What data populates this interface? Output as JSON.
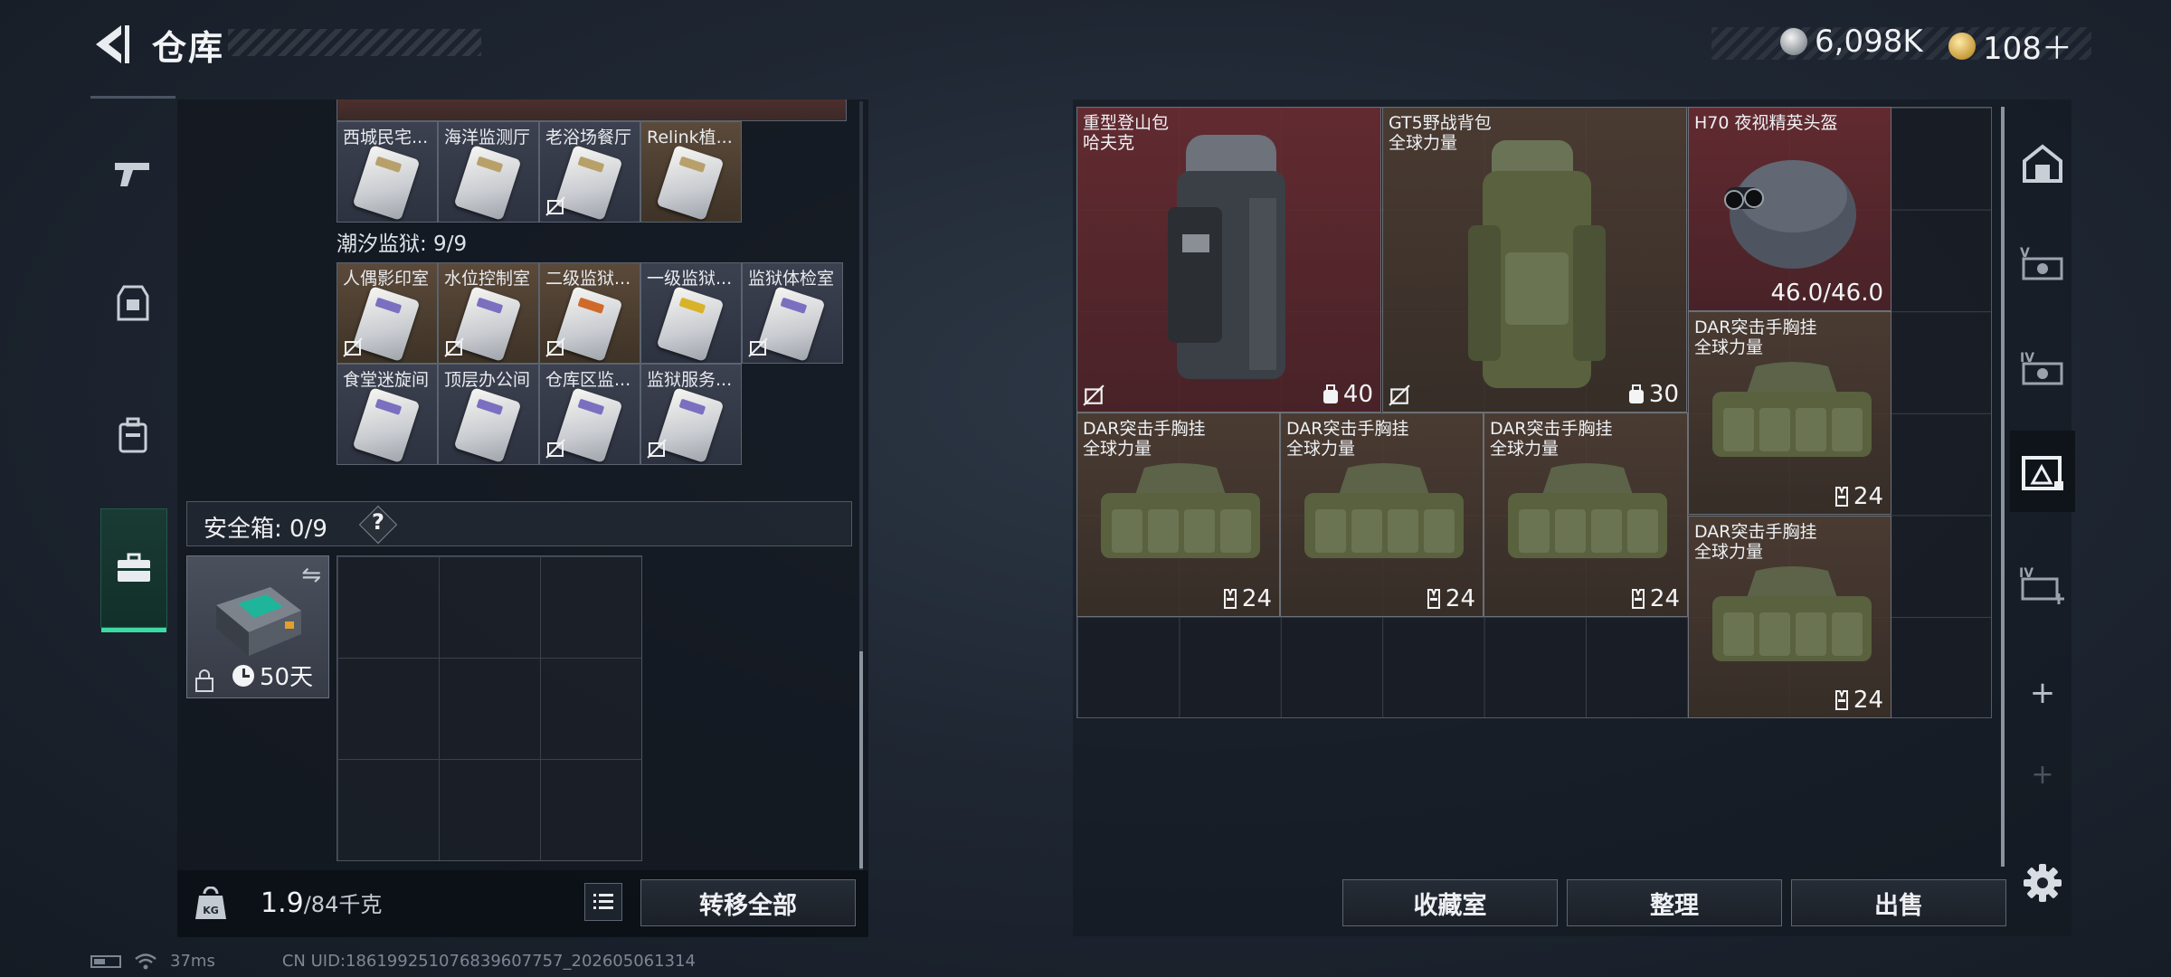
{
  "header": {
    "title": "仓库"
  },
  "currency": {
    "silver": {
      "value": "6,098K",
      "icon": "silver-coin-icon",
      "color": "#c8cdd2"
    },
    "gold": {
      "value": "108＋",
      "icon": "gold-coin-icon",
      "color": "#d9ab4b"
    }
  },
  "left_nav": {
    "items": [
      "weapon-tab",
      "gear-tab",
      "backpack-tab",
      "safe-case-tab"
    ],
    "active": "safe-case-tab",
    "active_color": "#3ddba4"
  },
  "keycards_top": {
    "row": [
      {
        "label": "西城民宅...",
        "tone": "gray",
        "no_bag": false
      },
      {
        "label": "海洋监测厅",
        "tone": "gray",
        "no_bag": false
      },
      {
        "label": "老浴场餐厅",
        "tone": "gray",
        "no_bag": true
      },
      {
        "label": "Relink植...",
        "tone": "brown",
        "no_bag": false
      }
    ]
  },
  "prison": {
    "title": "潮汐监狱: 9/9",
    "cards": [
      {
        "label": "人偶影印室",
        "tone": "brown",
        "no_bag": true,
        "stripe": "#7b6fc0"
      },
      {
        "label": "水位控制室",
        "tone": "brown",
        "no_bag": true,
        "stripe": "#7b6fc0"
      },
      {
        "label": "二级监狱...",
        "tone": "brown",
        "no_bag": true,
        "stripe": "#d06a2a"
      },
      {
        "label": "一级监狱...",
        "tone": "gray",
        "no_bag": false,
        "stripe": "#d8b32a"
      },
      {
        "label": "监狱体检室",
        "tone": "gray",
        "no_bag": true,
        "stripe": "#7b6fc0"
      },
      {
        "label": "食堂迷旋间",
        "tone": "gray",
        "no_bag": false,
        "stripe": "#7b6fc0"
      },
      {
        "label": "顶层办公间",
        "tone": "gray",
        "no_bag": false,
        "stripe": "#7b6fc0"
      },
      {
        "label": "仓库区监...",
        "tone": "gray",
        "no_bag": true,
        "stripe": "#7b6fc0"
      },
      {
        "label": "监狱服务...",
        "tone": "gray",
        "no_bag": true,
        "stripe": "#7b6fc0"
      }
    ]
  },
  "safe_case": {
    "label": "安全箱: 0/9",
    "help": "?",
    "days": "50天"
  },
  "bottom_left": {
    "weight_current": "1.9",
    "weight_max": "/84千克",
    "transfer_all": "转移全部"
  },
  "stash_items": [
    {
      "name1": "重型登山包",
      "name2": "哈夫克",
      "count": "40",
      "tone": "red",
      "no_bag": true,
      "count_icon": "backpack-icon"
    },
    {
      "name1": "GT5野战背包",
      "name2": "全球力量",
      "count": "30",
      "tone": "brown",
      "no_bag": true,
      "count_icon": "backpack-icon"
    },
    {
      "name1": "H70 夜视精英头盔",
      "name2": "",
      "count": "46.0/46.0",
      "tone": "red",
      "no_bag": false,
      "count_icon": ""
    },
    {
      "name1": "DAR突击手胸挂",
      "name2": "全球力量",
      "count": "24",
      "tone": "brown",
      "no_bag": false,
      "count_icon": "vest-icon"
    },
    {
      "name1": "DAR突击手胸挂",
      "name2": "全球力量",
      "count": "24",
      "tone": "brown",
      "no_bag": false,
      "count_icon": "vest-icon"
    },
    {
      "name1": "DAR突击手胸挂",
      "name2": "全球力量",
      "count": "24",
      "tone": "brown",
      "no_bag": false,
      "count_icon": "vest-icon"
    },
    {
      "name1": "DAR突击手胸挂",
      "name2": "全球力量",
      "count": "24",
      "tone": "brown",
      "no_bag": false,
      "count_icon": "vest-icon"
    },
    {
      "name1": "DAR突击手胸挂",
      "name2": "全球力量",
      "count": "24",
      "tone": "brown",
      "no_bag": false,
      "count_icon": "vest-icon"
    }
  ],
  "bottom_right": {
    "collection": "收藏室",
    "organize": "整理",
    "sell": "出售"
  },
  "right_nav": {
    "items": [
      "stash-main-tab",
      "stash-v-tab",
      "stash-iv-tab",
      "stash-active-tab",
      "stash-iv-add-tab",
      "add-tab",
      "add-tab-disabled",
      "settings"
    ],
    "active": "stash-active-tab"
  },
  "status": {
    "ping": "37ms",
    "uid": "CN UID:18619925107683960775​7_202605061314"
  }
}
